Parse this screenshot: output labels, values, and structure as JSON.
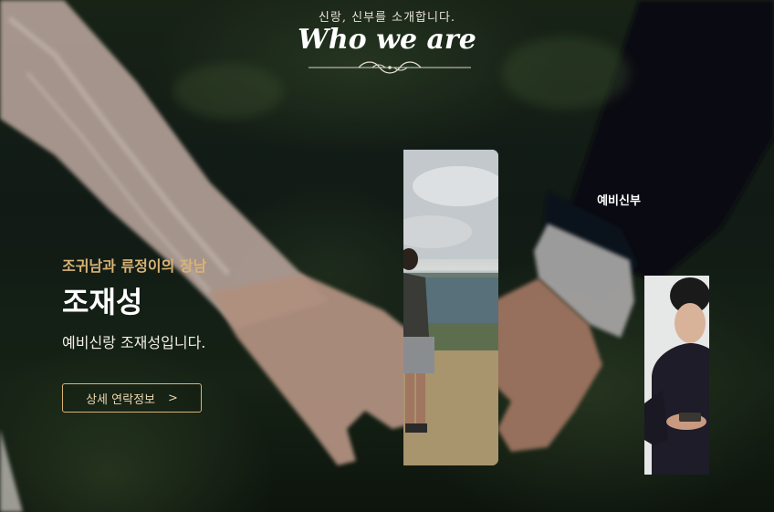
{
  "intro": {
    "subtitle": "신랑, 신부를 소개합니다.",
    "title": "Who we are"
  },
  "groom": {
    "parents_line": "조귀남과 류정이의 장남",
    "name": "조재성",
    "description": "예비신랑 조재성입니다.",
    "contact_button_label": "상세 연락정보",
    "contact_button_arrow": ">"
  },
  "bride_tab": {
    "label": "예비신부"
  },
  "colors": {
    "accent_gold": "#d9b274",
    "text_white": "#ffffff"
  },
  "icons": {
    "ornament": "flourish-divider-icon"
  }
}
